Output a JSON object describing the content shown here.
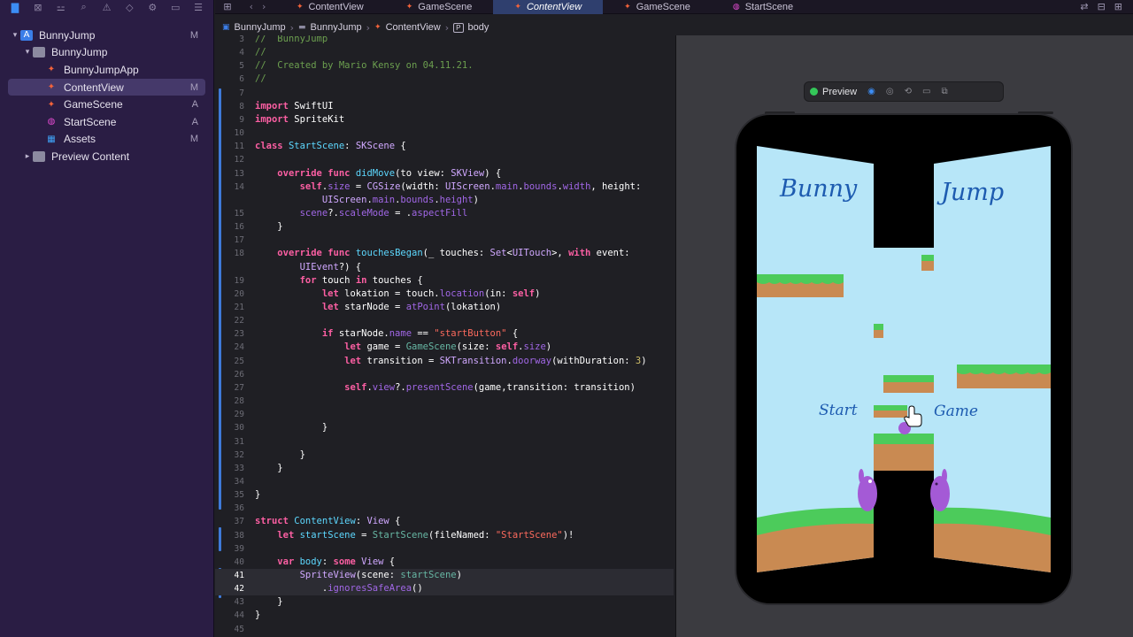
{
  "app": {
    "accent": "#3c8df5"
  },
  "sidebar": {
    "toolbar_icons": [
      "folder-icon",
      "source-control-icon",
      "hierarchy-icon",
      "find-icon",
      "warning-icon",
      "test-icon",
      "debug-icon",
      "breakpoint-icon",
      "report-icon"
    ],
    "items": [
      {
        "label": "BunnyJump",
        "icon": "project-icon",
        "status": "M",
        "indent": 0,
        "disclosure": "▾"
      },
      {
        "label": "BunnyJump",
        "icon": "folder-icon",
        "status": "",
        "indent": 1,
        "disclosure": "▾"
      },
      {
        "label": "BunnyJumpApp",
        "icon": "swift-file-icon",
        "status": "",
        "indent": 2,
        "disclosure": ""
      },
      {
        "label": "ContentView",
        "icon": "swift-file-icon",
        "status": "M",
        "indent": 2,
        "disclosure": "",
        "selected": true
      },
      {
        "label": "GameScene",
        "icon": "swift-file-icon",
        "status": "A",
        "indent": 2,
        "disclosure": ""
      },
      {
        "label": "StartScene",
        "icon": "spritekit-scene-icon",
        "status": "A",
        "indent": 2,
        "disclosure": ""
      },
      {
        "label": "Assets",
        "icon": "asset-catalog-icon",
        "status": "M",
        "indent": 2,
        "disclosure": ""
      },
      {
        "label": "Preview Content",
        "icon": "folder-icon",
        "status": "",
        "indent": 1,
        "disclosure": "▸"
      }
    ]
  },
  "tabs": [
    {
      "label": "ContentView",
      "kind": "swift",
      "active": false
    },
    {
      "label": "GameScene",
      "kind": "swift",
      "active": false
    },
    {
      "label": "ContentView",
      "kind": "swift",
      "active": true
    },
    {
      "label": "GameScene",
      "kind": "swift",
      "active": false
    },
    {
      "label": "StartScene",
      "kind": "sks",
      "active": false
    }
  ],
  "jumpbar": {
    "project": "BunnyJump",
    "folder": "BunnyJump",
    "file": "ContentView",
    "symbol": "body",
    "symbol_badge": "P"
  },
  "code": [
    {
      "n": "3",
      "h": "<span class=\"c\">//  BunnyJump</span>"
    },
    {
      "n": "4",
      "h": "<span class=\"c\">//</span>"
    },
    {
      "n": "5",
      "h": "<span class=\"c\">//  Created by Mario Kensy on 04.11.21.</span>"
    },
    {
      "n": "6",
      "h": "<span class=\"c\">//</span>"
    },
    {
      "n": "7",
      "h": ""
    },
    {
      "n": "8",
      "h": "<span class=\"k\">import</span> SwiftUI"
    },
    {
      "n": "9",
      "h": "<span class=\"k\">import</span> SpriteKit"
    },
    {
      "n": "10",
      "h": ""
    },
    {
      "n": "11",
      "h": "<span class=\"k\">class</span> <span class=\"t\">StartScene</span>: <span class=\"ty\">SKScene</span> {"
    },
    {
      "n": "12",
      "h": ""
    },
    {
      "n": "13",
      "h": "    <span class=\"k\">override func</span> <span class=\"t\">didMove</span>(to view: <span class=\"ty\">SKView</span>) {"
    },
    {
      "n": "14",
      "h": "        <span class=\"k\">self</span>.<span class=\"pm\">size</span> = <span class=\"ty\">CGSize</span>(width: <span class=\"ty\">UIScreen</span>.<span class=\"pm\">main</span>.<span class=\"pm\">bounds</span>.<span class=\"pm\">width</span>, height:"
    },
    {
      "n": "",
      "h": "            <span class=\"ty\">UIScreen</span>.<span class=\"pm\">main</span>.<span class=\"pm\">bounds</span>.<span class=\"pm\">height</span>)"
    },
    {
      "n": "15",
      "h": "        <span class=\"pm\">scene</span>?.<span class=\"pm\">scaleMode</span> = .<span class=\"pm\">aspectFill</span>"
    },
    {
      "n": "16",
      "h": "    }"
    },
    {
      "n": "17",
      "h": ""
    },
    {
      "n": "18",
      "h": "    <span class=\"k\">override func</span> <span class=\"t\">touchesBegan</span>(_ touches: <span class=\"ty\">Set</span>&lt;<span class=\"ty\">UITouch</span>&gt;, <span class=\"k\">with</span> event:"
    },
    {
      "n": "",
      "h": "        <span class=\"ty\">UIEvent</span>?) {"
    },
    {
      "n": "19",
      "h": "        <span class=\"k\">for</span> touch <span class=\"k\">in</span> touches {"
    },
    {
      "n": "20",
      "h": "            <span class=\"k\">let</span> lokation = touch.<span class=\"pm\">location</span>(in: <span class=\"k\">self</span>)"
    },
    {
      "n": "21",
      "h": "            <span class=\"k\">let</span> starNode = <span class=\"pm\">atPoint</span>(lokation)"
    },
    {
      "n": "22",
      "h": ""
    },
    {
      "n": "23",
      "h": "            <span class=\"k\">if</span> starNode.<span class=\"pm\">name</span> == <span class=\"s\">\"startButton\"</span> {"
    },
    {
      "n": "24",
      "h": "                <span class=\"k\">let</span> game = <span class=\"f\">GameScene</span>(size: <span class=\"k\">self</span>.<span class=\"pm\">size</span>)"
    },
    {
      "n": "25",
      "h": "                <span class=\"k\">let</span> transition = <span class=\"ty\">SKTransition</span>.<span class=\"pm\">doorway</span>(withDuration: <span class=\"n\">3</span>)"
    },
    {
      "n": "26",
      "h": ""
    },
    {
      "n": "27",
      "h": "                <span class=\"k\">self</span>.<span class=\"pm\">view</span>?.<span class=\"pm\">presentScene</span>(game,transition: transition)"
    },
    {
      "n": "28",
      "h": ""
    },
    {
      "n": "29",
      "h": ""
    },
    {
      "n": "30",
      "h": "            }"
    },
    {
      "n": "31",
      "h": ""
    },
    {
      "n": "32",
      "h": "        }"
    },
    {
      "n": "33",
      "h": "    }"
    },
    {
      "n": "34",
      "h": ""
    },
    {
      "n": "35",
      "h": "}"
    },
    {
      "n": "36",
      "h": ""
    },
    {
      "n": "37",
      "h": "<span class=\"k\">struct</span> <span class=\"t\">ContentView</span>: <span class=\"ty\">View</span> {"
    },
    {
      "n": "38",
      "h": "    <span class=\"k\">let</span> <span class=\"t\">startScene</span> = <span class=\"f\">StartScene</span>(fileNamed: <span class=\"s\">\"StartScene\"</span>)!"
    },
    {
      "n": "39",
      "h": ""
    },
    {
      "n": "40",
      "h": "    <span class=\"k\">var</span> <span class=\"t\">body</span>: <span class=\"k\">some</span> <span class=\"ty\">View</span> {"
    },
    {
      "n": "41",
      "h": "        <span class=\"ty\">SpriteView</span>(scene: <span class=\"f\">startScene</span>)",
      "cur": true
    },
    {
      "n": "42",
      "h": "            .<span class=\"pm\">ignoresSafeArea</span>()",
      "cur": true
    },
    {
      "n": "43",
      "h": "    }"
    },
    {
      "n": "44",
      "h": "}"
    },
    {
      "n": "45",
      "h": ""
    }
  ],
  "preview": {
    "label": "Preview",
    "icons": [
      "live-mode-icon",
      "inspect-icon",
      "rotate-icon",
      "device-settings-icon",
      "duplicate-icon"
    ]
  },
  "game": {
    "title_left": "Bunny",
    "title_right": "Jump",
    "start_left": "Start",
    "start_right": "Game",
    "colors": {
      "sky": "#b7e6f8",
      "grass": "#4ccb5b",
      "dirt": "#c98a52",
      "text": "#1d5bb0",
      "bunny": "#a45ad6"
    }
  }
}
